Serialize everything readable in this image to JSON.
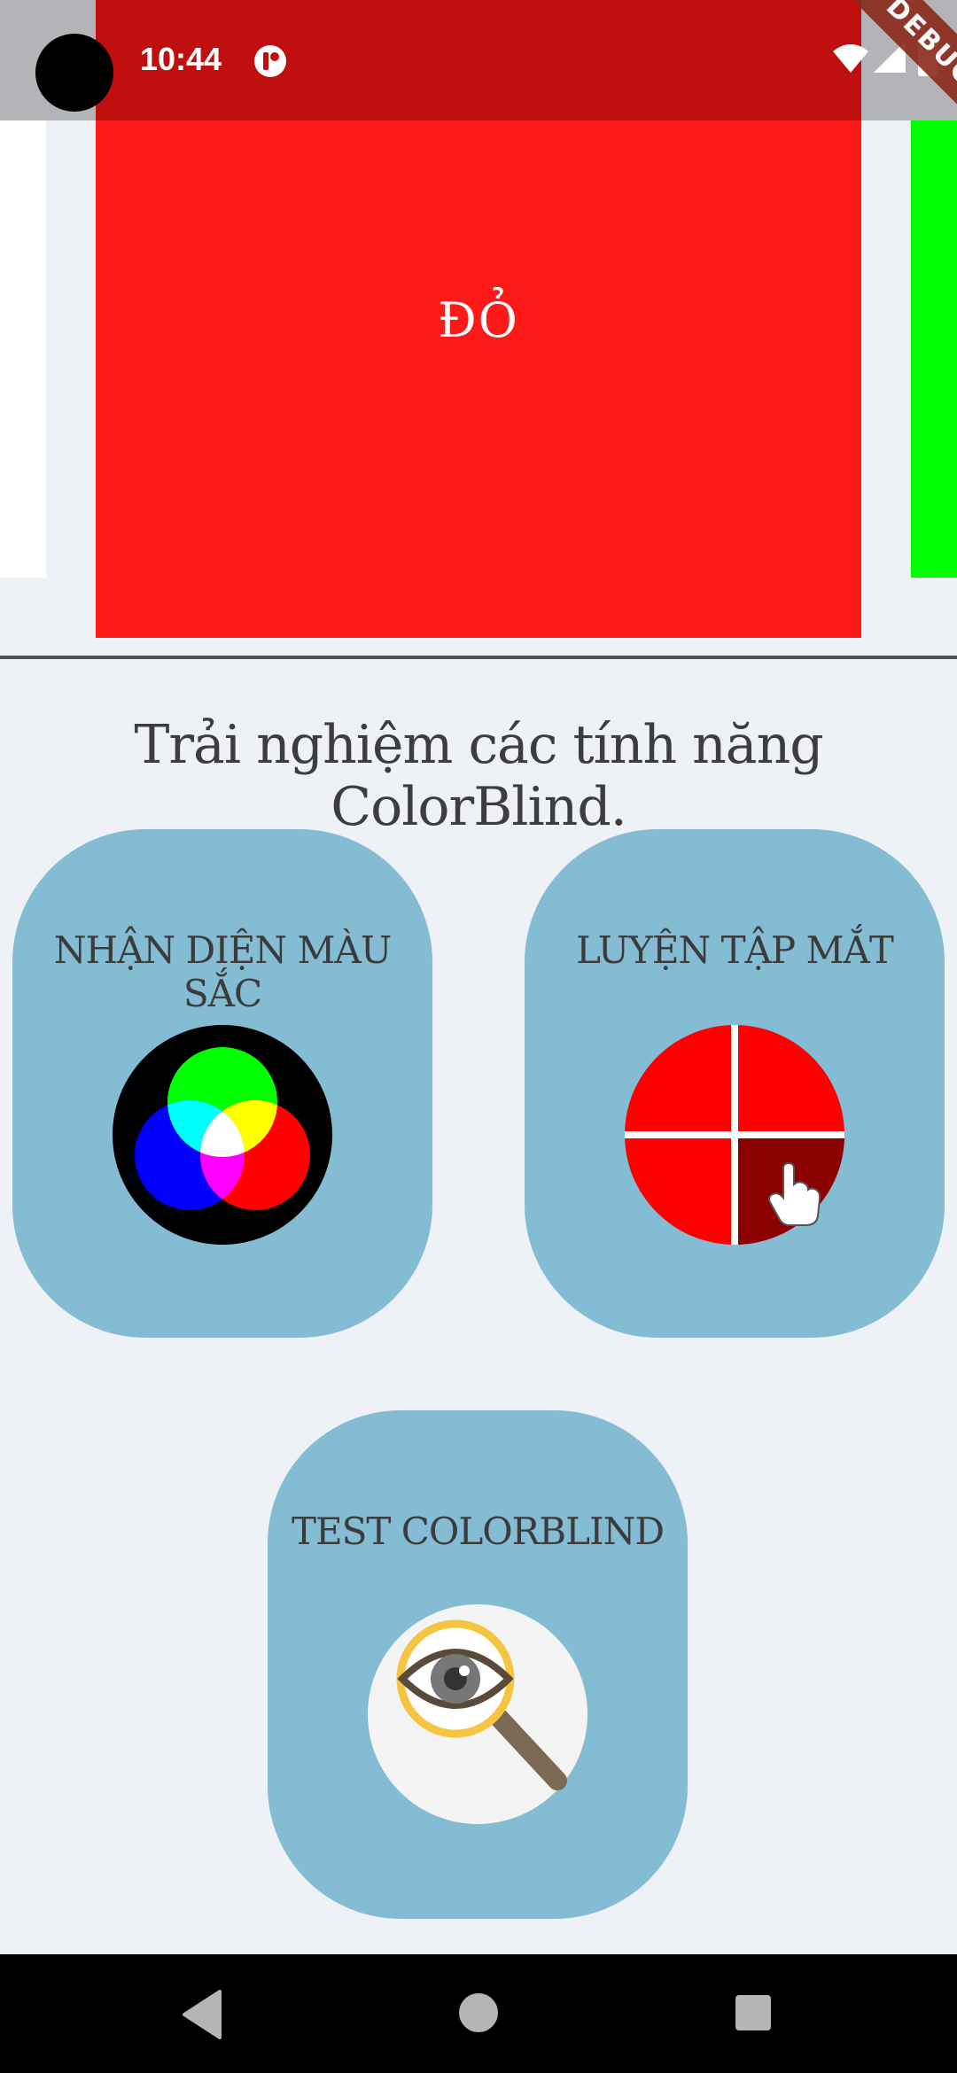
{
  "status_bar": {
    "time": "10:44",
    "icons": [
      "camera-hole",
      "app-notification-icon",
      "wifi-icon",
      "signal-icon",
      "battery-icon"
    ],
    "debug_banner": "DEBUG"
  },
  "carousel": {
    "cards": [
      {
        "color": "#ffffff",
        "label": ""
      },
      {
        "color": "#ff1a1a",
        "label": "ĐỎ"
      },
      {
        "color": "#00ff00",
        "label": ""
      }
    ]
  },
  "section": {
    "heading": "Trải nghiệm các tính năng ColorBlind."
  },
  "features": [
    {
      "title": "NHẬN DIỆN MÀU SẮC",
      "icon": "rgb-color-wheel-icon"
    },
    {
      "title": "LUYỆN TẬP MẮT",
      "icon": "eye-training-grid-icon"
    },
    {
      "title": "TEST COLORBLIND",
      "icon": "magnifier-eye-icon"
    }
  ],
  "colors": {
    "background": "#eef1f5",
    "card": "#84bcd4",
    "text": "#3b3b3b",
    "divider": "#505050"
  },
  "nav_bar": {
    "icons": [
      "back-icon",
      "home-icon",
      "recents-icon"
    ]
  }
}
